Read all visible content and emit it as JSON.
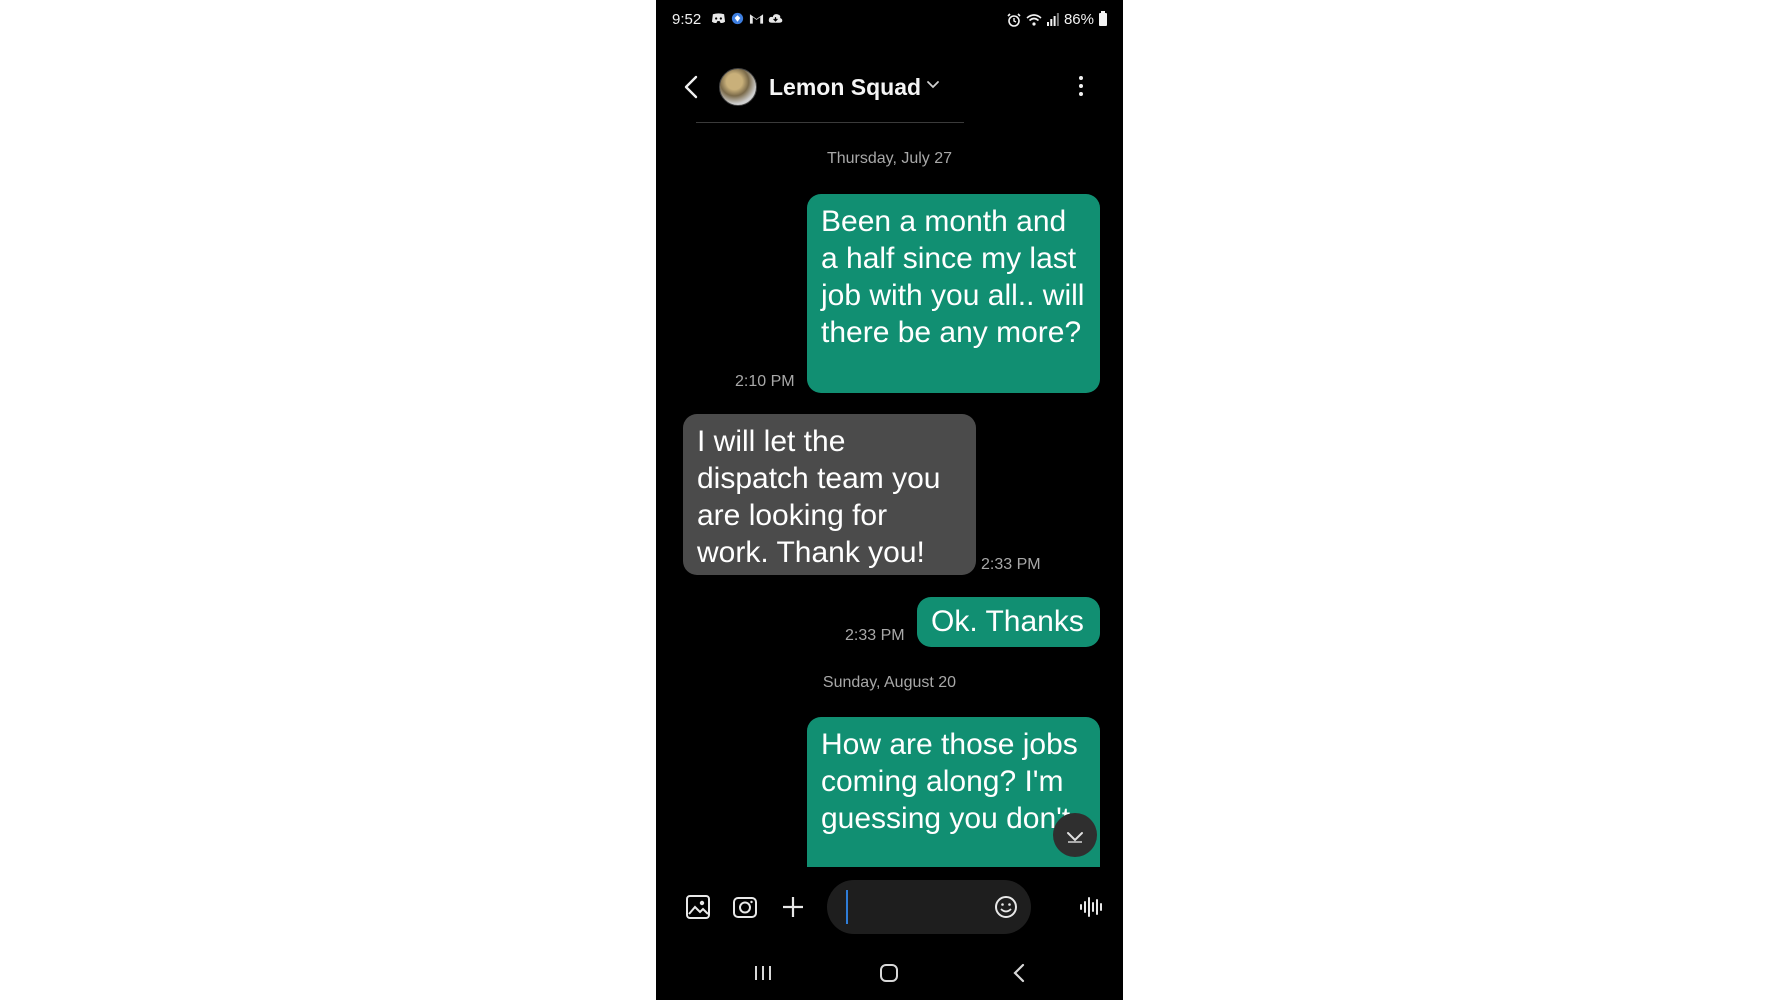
{
  "status_bar": {
    "time": "9:52",
    "battery": "86%",
    "left_icons": [
      "discord-icon",
      "vpn-icon",
      "gmail-icon",
      "cloud-icon"
    ],
    "right_icons": [
      "alarm-icon",
      "wifi-icon",
      "signal-icon",
      "battery-icon"
    ]
  },
  "header": {
    "title": "Lemon Squad"
  },
  "conversation": {
    "dates": [
      "Thursday, July 27",
      "Sunday, August 20"
    ],
    "messages": [
      {
        "direction": "outgoing",
        "text": "Been a month and a half since my last job with you all..  will there be any more?",
        "time": "2:10 PM"
      },
      {
        "direction": "incoming",
        "text": "I will let the dispatch team you are looking for work. Thank you!",
        "time": "2:33 PM"
      },
      {
        "direction": "outgoing",
        "text": "Ok. Thanks",
        "time": "2:33 PM"
      },
      {
        "direction": "outgoing",
        "text": "How are those jobs coming along? I'm guessing you don't",
        "time": ""
      }
    ]
  },
  "composer": {
    "value": "",
    "placeholder": "",
    "icons": [
      "gallery-icon",
      "camera-icon",
      "plus-icon",
      "emoji-icon",
      "voice-record-icon"
    ]
  },
  "colors": {
    "outgoing_bubble": "#118f72",
    "incoming_bubble": "#4b4b4b",
    "background": "#000000",
    "timestamp": "#a8a8a8",
    "cursor": "#2f7dd8"
  }
}
